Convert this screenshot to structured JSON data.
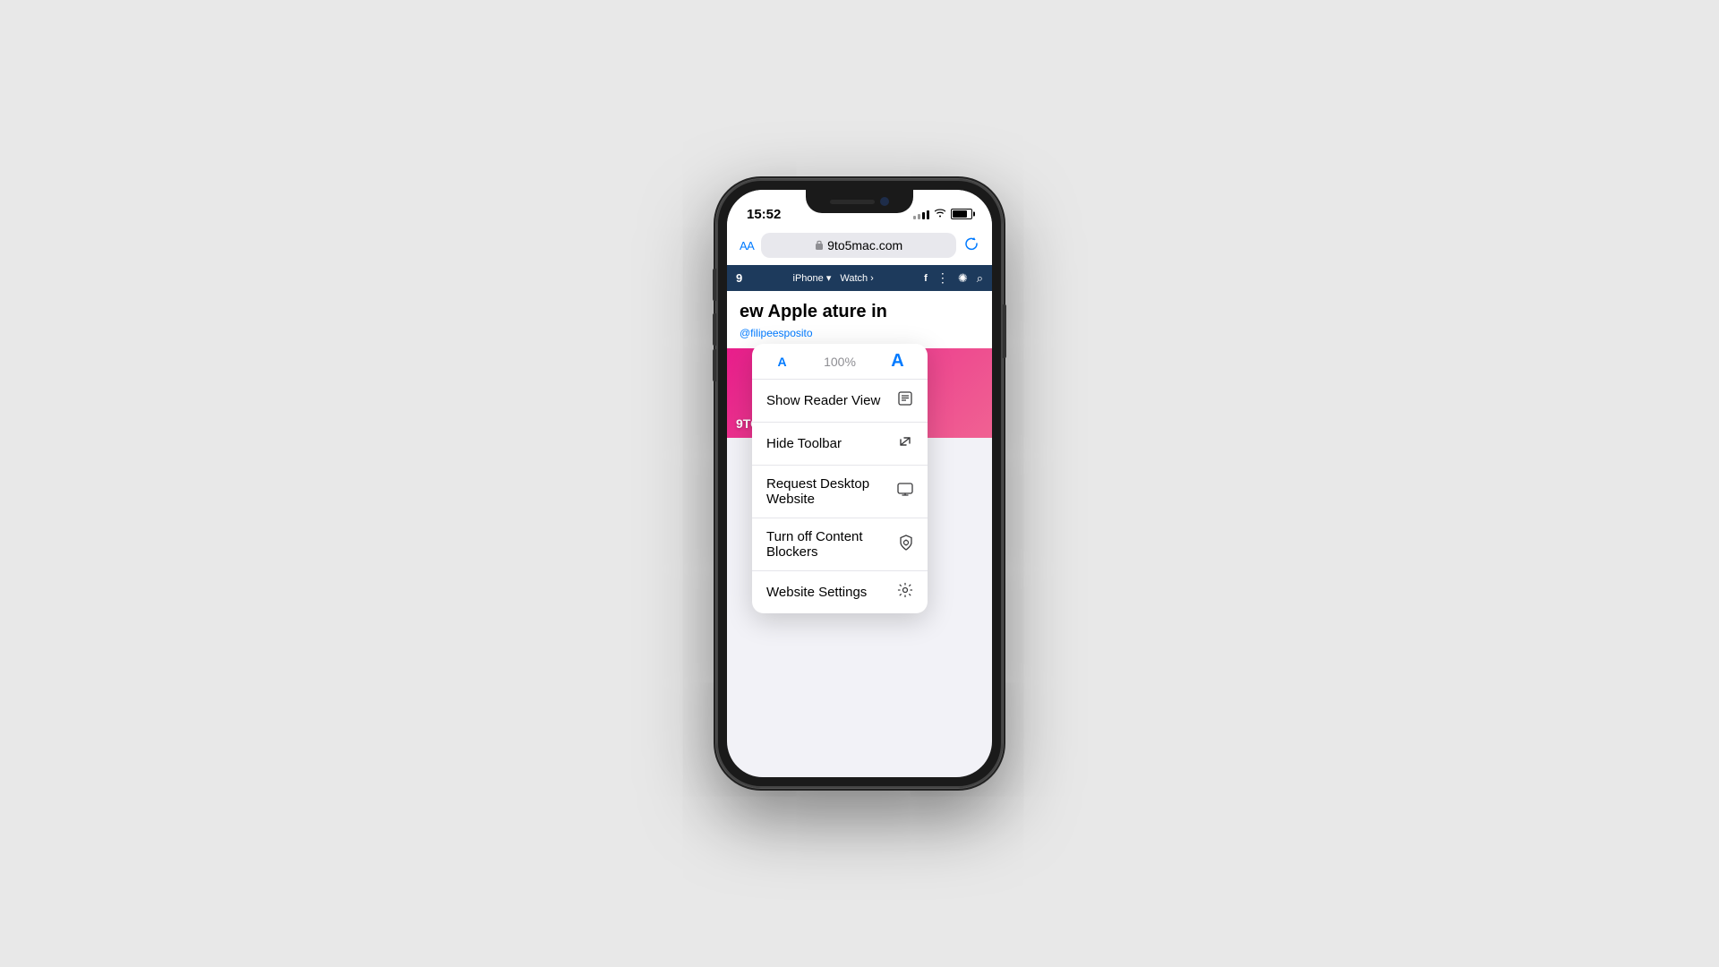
{
  "background": "#e8e8e8",
  "phone": {
    "status_bar": {
      "time": "15:52",
      "signal_bars": [
        4,
        6,
        8,
        10,
        12
      ],
      "battery_level": "80"
    },
    "url_bar": {
      "aa_label": "AA",
      "lock_symbol": "🔒",
      "url": "9to5mac.com",
      "reload_symbol": "↻"
    },
    "font_popup": {
      "small_a": "A",
      "percent": "100%",
      "large_a": "A",
      "menu_items": [
        {
          "label": "Show Reader View",
          "icon": "reader",
          "icon_symbol": "⊟"
        },
        {
          "label": "Hide Toolbar",
          "icon": "resize",
          "icon_symbol": "⤢"
        },
        {
          "label": "Request Desktop Website",
          "icon": "desktop",
          "icon_symbol": "🖥"
        },
        {
          "label": "Turn off Content Blockers",
          "icon": "shield",
          "icon_symbol": "⊙"
        },
        {
          "label": "Website Settings",
          "icon": "gear",
          "icon_symbol": "⚙"
        }
      ]
    },
    "website": {
      "nav_items": [
        "9",
        "iPhone ▾",
        "Watch ›"
      ],
      "nav_icons": [
        "f",
        "⋮",
        "☀",
        "⌕"
      ],
      "article_title": "ew Apple\nature in",
      "article_author": "@filipeesposito",
      "banner_text": "9TO5Mac"
    }
  }
}
